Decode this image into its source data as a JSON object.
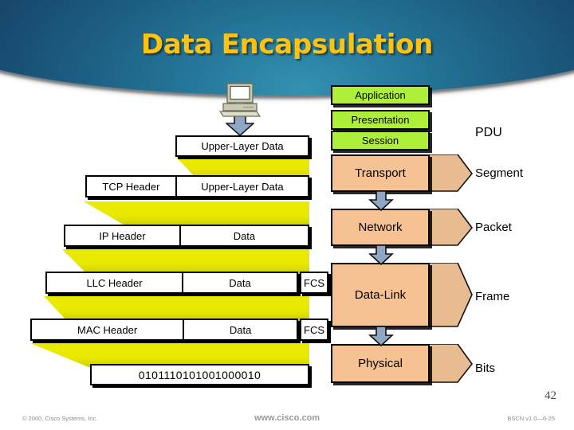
{
  "slide": {
    "title": "Data Encapsulation",
    "page_number": "42",
    "accent_color": "#ffc20e",
    "banner_color": "#124a72"
  },
  "encapsulation": {
    "source_icon": "desktop-computer-icon",
    "rows": [
      {
        "name": "upper-layer-data",
        "cells": [
          {
            "label": "Upper-Layer Data"
          }
        ],
        "fcs": null
      },
      {
        "name": "tcp-segment",
        "cells": [
          {
            "label": "TCP Header"
          },
          {
            "label": "Upper-Layer Data"
          }
        ],
        "fcs": null
      },
      {
        "name": "ip-packet",
        "cells": [
          {
            "label": "IP Header"
          },
          {
            "label": "Data"
          }
        ],
        "fcs": null
      },
      {
        "name": "llc-frame",
        "cells": [
          {
            "label": "LLC Header"
          },
          {
            "label": "Data"
          }
        ],
        "fcs": "FCS"
      },
      {
        "name": "mac-frame",
        "cells": [
          {
            "label": "MAC Header"
          },
          {
            "label": "Data"
          }
        ],
        "fcs": "FCS"
      },
      {
        "name": "bit-stream",
        "cells": [
          {
            "label": "0101110101001000010"
          }
        ],
        "fcs": null
      }
    ]
  },
  "osi_stack": {
    "header_label": "PDU",
    "upper_layers": [
      {
        "label": "Application",
        "color": "#aef039"
      },
      {
        "label": "Presentation",
        "color": "#aef039"
      },
      {
        "label": "Session",
        "color": "#aef039"
      }
    ],
    "lower_layers": [
      {
        "label": "Transport",
        "color": "#f7c293",
        "pdu": "Segment"
      },
      {
        "label": "Network",
        "color": "#f7c293",
        "pdu": "Packet"
      },
      {
        "label": "Data-Link",
        "color": "#f7c293",
        "pdu": "Frame"
      },
      {
        "label": "Physical",
        "color": "#f7c293",
        "pdu": "Bits"
      }
    ]
  },
  "footer": {
    "copyright": "© 2000, Cisco Systems, Inc.",
    "website": "www.cisco.com",
    "course_code": "BSCN v1.0—6-25"
  }
}
